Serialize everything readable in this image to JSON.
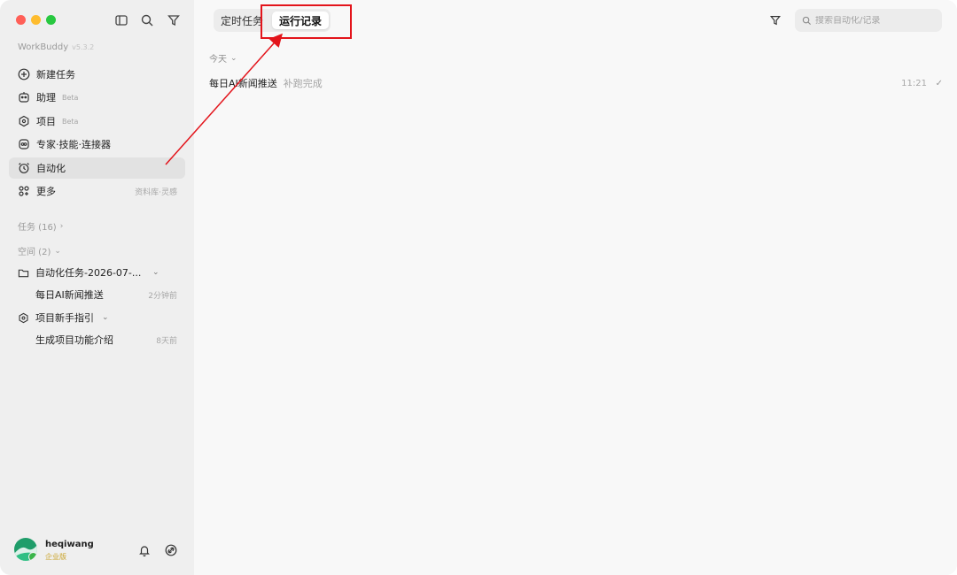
{
  "app": {
    "name": "WorkBuddy",
    "version": "v5.3.2"
  },
  "sidebar": {
    "nav": [
      {
        "label": "新建任务",
        "icon": "plus-circle-icon"
      },
      {
        "label": "助理",
        "badge": "Beta",
        "icon": "assistant-icon"
      },
      {
        "label": "项目",
        "badge": "Beta",
        "icon": "project-icon"
      },
      {
        "label": "专家·技能·连接器",
        "icon": "experts-icon"
      },
      {
        "label": "自动化",
        "icon": "alarm-clock-icon",
        "active": true
      },
      {
        "label": "更多",
        "right": "资料库·灵感",
        "icon": "grid-icon"
      }
    ],
    "tasks_header": "任务 (16)",
    "spaces_header": "空间 (2)",
    "spaces": [
      {
        "label": "自动化任务-2026-07-...",
        "icon": "folder-icon",
        "children": [
          {
            "label": "每日AI新闻推送",
            "time": "2分钟前"
          }
        ]
      },
      {
        "label": "项目新手指引",
        "icon": "project-icon",
        "children": [
          {
            "label": "生成项目功能介绍",
            "time": "8天前"
          }
        ]
      }
    ],
    "user": {
      "name": "heqiwang",
      "plan": "企业版"
    }
  },
  "main": {
    "tabs": [
      {
        "label": "定时任务"
      },
      {
        "label": "运行记录",
        "active": true
      }
    ],
    "search_placeholder": "搜索自动化/记录",
    "date_group": "今天",
    "runs": [
      {
        "name": "每日AI新闻推送",
        "status": "补跑完成",
        "time": "11:21"
      }
    ]
  },
  "colors": {
    "annotation": "#e3141b",
    "sidebar_bg": "#efefef",
    "main_bg": "#f8f8f8"
  }
}
